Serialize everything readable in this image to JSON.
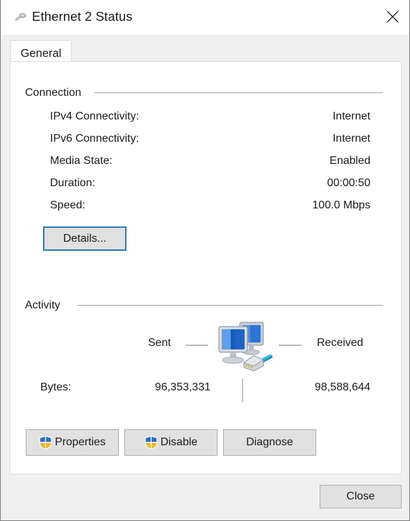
{
  "window": {
    "title": "Ethernet 2 Status",
    "title_icon": "network-cable-icon",
    "close_icon": "close-icon"
  },
  "tabs": [
    {
      "label": "General",
      "active": true
    }
  ],
  "connection": {
    "group_label": "Connection",
    "rows": [
      {
        "label": "IPv4 Connectivity:",
        "value": "Internet"
      },
      {
        "label": "IPv6 Connectivity:",
        "value": "Internet"
      },
      {
        "label": "Media State:",
        "value": "Enabled"
      },
      {
        "label": "Duration:",
        "value": "00:00:50"
      },
      {
        "label": "Speed:",
        "value": "100.0 Mbps"
      }
    ],
    "details_button": {
      "label": "Details...",
      "focused": true
    }
  },
  "activity": {
    "group_label": "Activity",
    "sent_label": "Sent",
    "received_label": "Received",
    "icon": "computer-network-icon",
    "bytes_label": "Bytes:",
    "bytes_sent": "96,353,331",
    "bytes_received": "98,588,644"
  },
  "action_buttons": [
    {
      "label": "Properties",
      "icon": "uac-shield-icon"
    },
    {
      "label": "Disable",
      "icon": "uac-shield-icon"
    },
    {
      "label": "Diagnose",
      "icon": null
    }
  ],
  "footer": {
    "close_label": "Close"
  },
  "colors": {
    "window_bg": "#f0f0f0",
    "panel_bg": "#ffffff",
    "button_face": "#e1e1e1",
    "button_border": "#adadad",
    "focus_border": "#2a7ab0",
    "text": "#1a1a1a",
    "group_line": "#a0a0a0",
    "shield_blue": "#2a6fc9",
    "shield_yellow": "#f0b323"
  }
}
